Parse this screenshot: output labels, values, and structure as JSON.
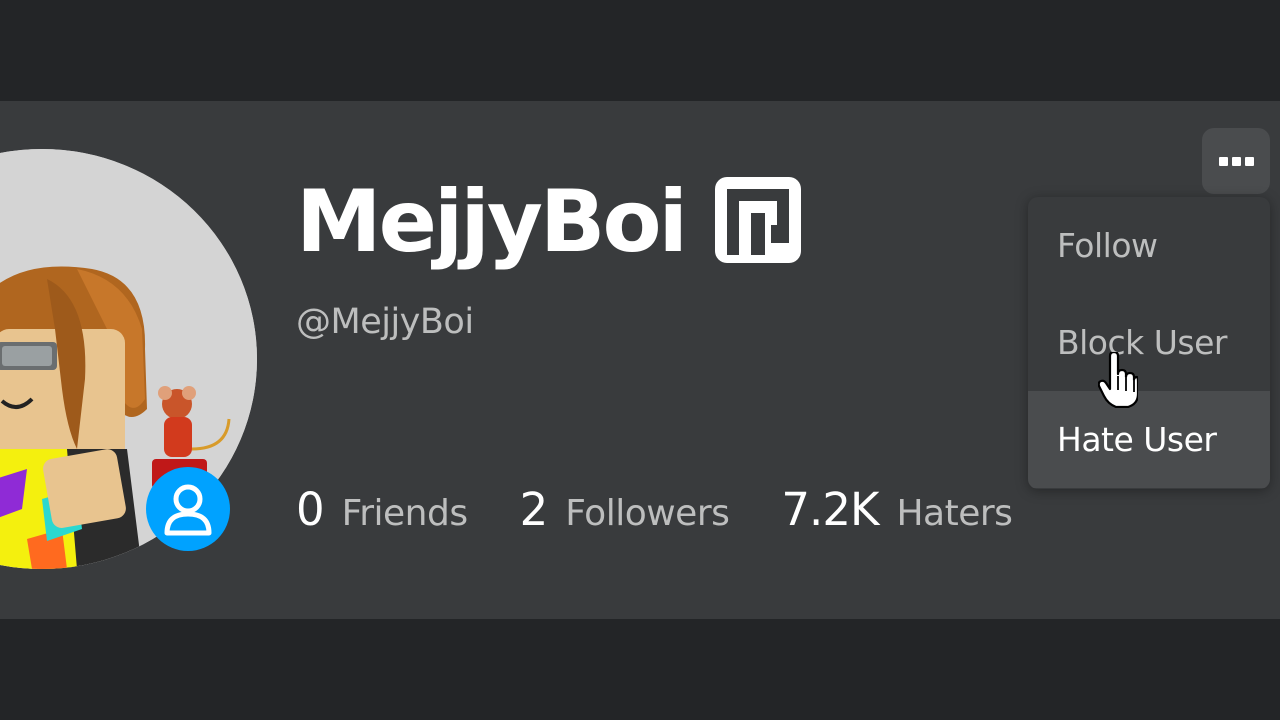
{
  "profile": {
    "display_name": "MejjyBoi",
    "username": "@MejjyBoi",
    "verified_badge_icon": "premium-badge-icon",
    "presence_icon": "user-presence-icon"
  },
  "stats": [
    {
      "value": "0",
      "label": "Friends"
    },
    {
      "value": "2",
      "label": "Followers"
    },
    {
      "value": "7.2K",
      "label": "Haters"
    }
  ],
  "menu": {
    "button_icon": "more-options-icon",
    "items": [
      {
        "label": "Follow"
      },
      {
        "label": "Block User"
      },
      {
        "label": "Hate User"
      }
    ],
    "hovered_item": "Hate User"
  },
  "colors": {
    "page_bg": "#232527",
    "card_bg": "#393b3d",
    "presence_blue": "#00a2ff",
    "text_primary": "#ffffff",
    "text_secondary": "#bdbebe"
  }
}
